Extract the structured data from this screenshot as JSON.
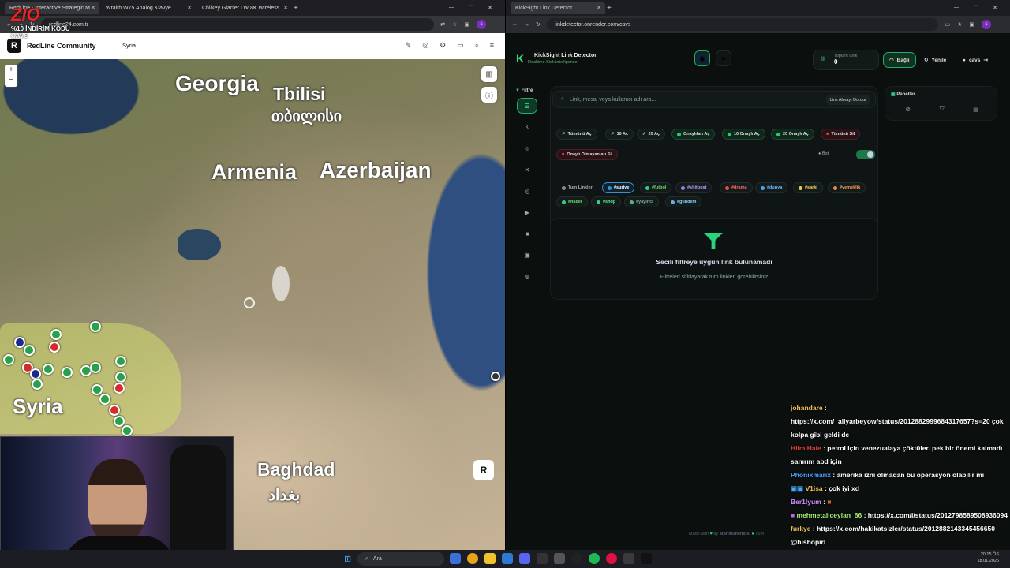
{
  "left_browser": {
    "tabs": [
      {
        "title": "RedLine - Interactive Strategic M"
      },
      {
        "title": "Wraith W75 Analog Klavye"
      },
      {
        "title": "Chilkey Glacier LW 8K Wireless"
      }
    ],
    "url": "redline24.com.tr",
    "site": {
      "brand": "RedLine Community",
      "logo": "R",
      "nav_item": "Syria"
    },
    "map_labels": {
      "georgia": "Georgia",
      "tbilisi": "Tbilisi",
      "tbilisi_geo": "თბილისი",
      "armenia": "Armenia",
      "azerbaijan": "Azerbaijan",
      "syria": "Syria",
      "baghdad": "Baghdad",
      "baghdad_ar": "بغداد"
    },
    "zoom_plus": "+",
    "zoom_minus": "−",
    "r_button": "R"
  },
  "overlay": {
    "brand": "ZIO",
    "promo": "%10 İNDİRİM KODU",
    "code": "CAVS"
  },
  "right_browser": {
    "tab_title": "KickSight Link Detector",
    "url": "linkdetector.onrender.com/cavs",
    "app": {
      "title": "KickSight Link Detector",
      "subtitle": "Realtime Kick intelligence",
      "stat_label": "Toplam Link",
      "stat_value": "0",
      "connected": "Bağlı",
      "refresh": "Yenile",
      "user": "cavs",
      "filter_label": "Filtre",
      "panels_label": "Paneller",
      "search_placeholder": "Link, mesaj veya kullanıcı adı ara...",
      "stop_button": "Link Almayı Durdur",
      "actions": [
        "Tümünü Aç",
        "10 Aç",
        "20 Aç",
        "Onaylıları Aç",
        "10 Onaylı Aç",
        "20 Onaylı Aç",
        "Tümünü Sil",
        "Onaylı Olmayanları Sil"
      ],
      "bot_label": "Bot",
      "tags": [
        "Tum Linkler",
        "#suriye",
        "#futbol",
        "#shitpost",
        "#drama",
        "#dunya",
        "#sarki",
        "#yemeklik",
        "#haber",
        "#shop",
        "#yayıncı",
        "#gündem"
      ],
      "empty_title": "Secili filtreye uygun link bulunamadi",
      "empty_sub": "Filtreleri sifirlayarak tum linkleri gorebilirsiniz",
      "footer": {
        "made_with": "Made with",
        "by": "by",
        "author": "atarimuhendisi",
        "more": "Tüm"
      }
    }
  },
  "chat": [
    {
      "user": "johandare",
      "color": "#f0c05a",
      "msg": " : https://x.com/_aliyarbeyow/status/2012882999684317657?s=20 çok kolpa gibi geldi de"
    },
    {
      "user": "HilmiHale",
      "color": "#e0413a",
      "msg": " : petrol için venezualaya çöktüler. pek bir önemi kalmadı sanırım abd için"
    },
    {
      "user": "Phonixmarix",
      "color": "#4aa3ff",
      "msg": " : amerika izni olmadan bu operasyon olabilir mi"
    },
    {
      "user": "V1isa",
      "color": "#f0c05a",
      "msg": " : çok iyi xd"
    },
    {
      "user": "Ber1lyum",
      "color": "#d08cff",
      "msg": " : "
    },
    {
      "user": "mehmetaliceylan_66",
      "color": "#a6f07a",
      "msg": " : https://x.com/i/status/2012798589508936094"
    },
    {
      "user": "furkye",
      "color": "#f0c05a",
      "msg": " : https://x.com/hakikatsizler/status/2012882143345456650"
    },
    {
      "user": "",
      "color": "#ffffff",
      "msg": "@bishopirl"
    }
  ],
  "taskbar": {
    "search": "Ara",
    "time": "20:15 ÖS",
    "date": "18.01.2026"
  }
}
